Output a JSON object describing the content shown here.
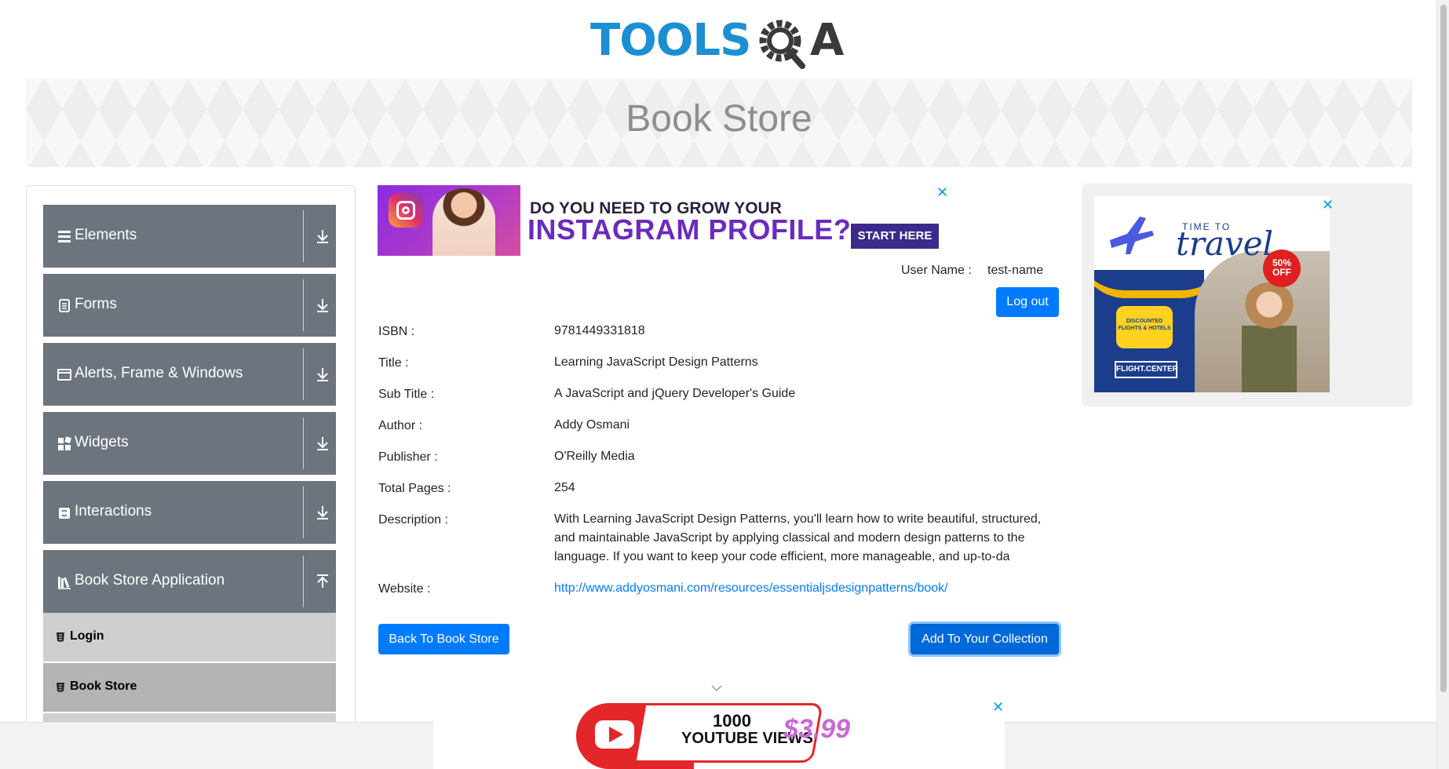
{
  "header": {
    "logo_text": "TOOLS",
    "logo_a": "A"
  },
  "banner": {
    "title": "Book Store"
  },
  "menu": {
    "groups": [
      {
        "label": "Elements",
        "icon": "hamburger-icon"
      },
      {
        "label": "Forms",
        "icon": "document-icon"
      },
      {
        "label": "Alerts, Frame & Windows",
        "icon": "window-icon"
      },
      {
        "label": "Widgets",
        "icon": "widgets-icon"
      },
      {
        "label": "Interactions",
        "icon": "interactions-icon"
      },
      {
        "label": "Book Store Application",
        "icon": "books-icon"
      }
    ],
    "sub_items": [
      {
        "label": "Login",
        "active": false
      },
      {
        "label": "Book Store",
        "active": true
      }
    ]
  },
  "ads": {
    "top": {
      "line1": "DO YOU NEED TO GROW YOUR",
      "line2": "INSTAGRAM PROFILE?",
      "cta": "START HERE",
      "close": "✕"
    },
    "right": {
      "time_to": "TIME TO",
      "travel": "travel",
      "badge": "50% OFF",
      "bubble": "DISCOUNTED FLIGHTS & HOTELS",
      "brand": "FLIGHT.CENTER",
      "close": "✕"
    },
    "bottom": {
      "views_count": "1000",
      "views_label": "YOUTUBE VIEWS",
      "price": "$3.99",
      "close": "✕"
    }
  },
  "user": {
    "label": "User Name :",
    "value": "test-name",
    "logout": "Log out"
  },
  "book": {
    "isbn_label": "ISBN :",
    "isbn": "9781449331818",
    "title_label": "Title :",
    "title": "Learning JavaScript Design Patterns",
    "subtitle_label": "Sub Title :",
    "subtitle": "A JavaScript and jQuery Developer's Guide",
    "author_label": "Author :",
    "author": "Addy Osmani",
    "publisher_label": "Publisher :",
    "publisher": "O'Reilly Media",
    "pages_label": "Total Pages :",
    "pages": "254",
    "description_label": "Description :",
    "description": "With Learning JavaScript Design Patterns, you'll learn how to write beautiful, structured, and maintainable JavaScript by applying classical and modern design patterns to the language. If you want to keep your code efficient, more manageable, and up-to-da",
    "website_label": "Website :",
    "website": "http://www.addyosmani.com/resources/essentialjsdesignpatterns/book/"
  },
  "actions": {
    "back": "Back To Book Store",
    "add": "Add To Your Collection"
  },
  "colors": {
    "primary": "#007bff",
    "menu_group": "#6c757d",
    "logo_blue": "#1b8fd2"
  }
}
